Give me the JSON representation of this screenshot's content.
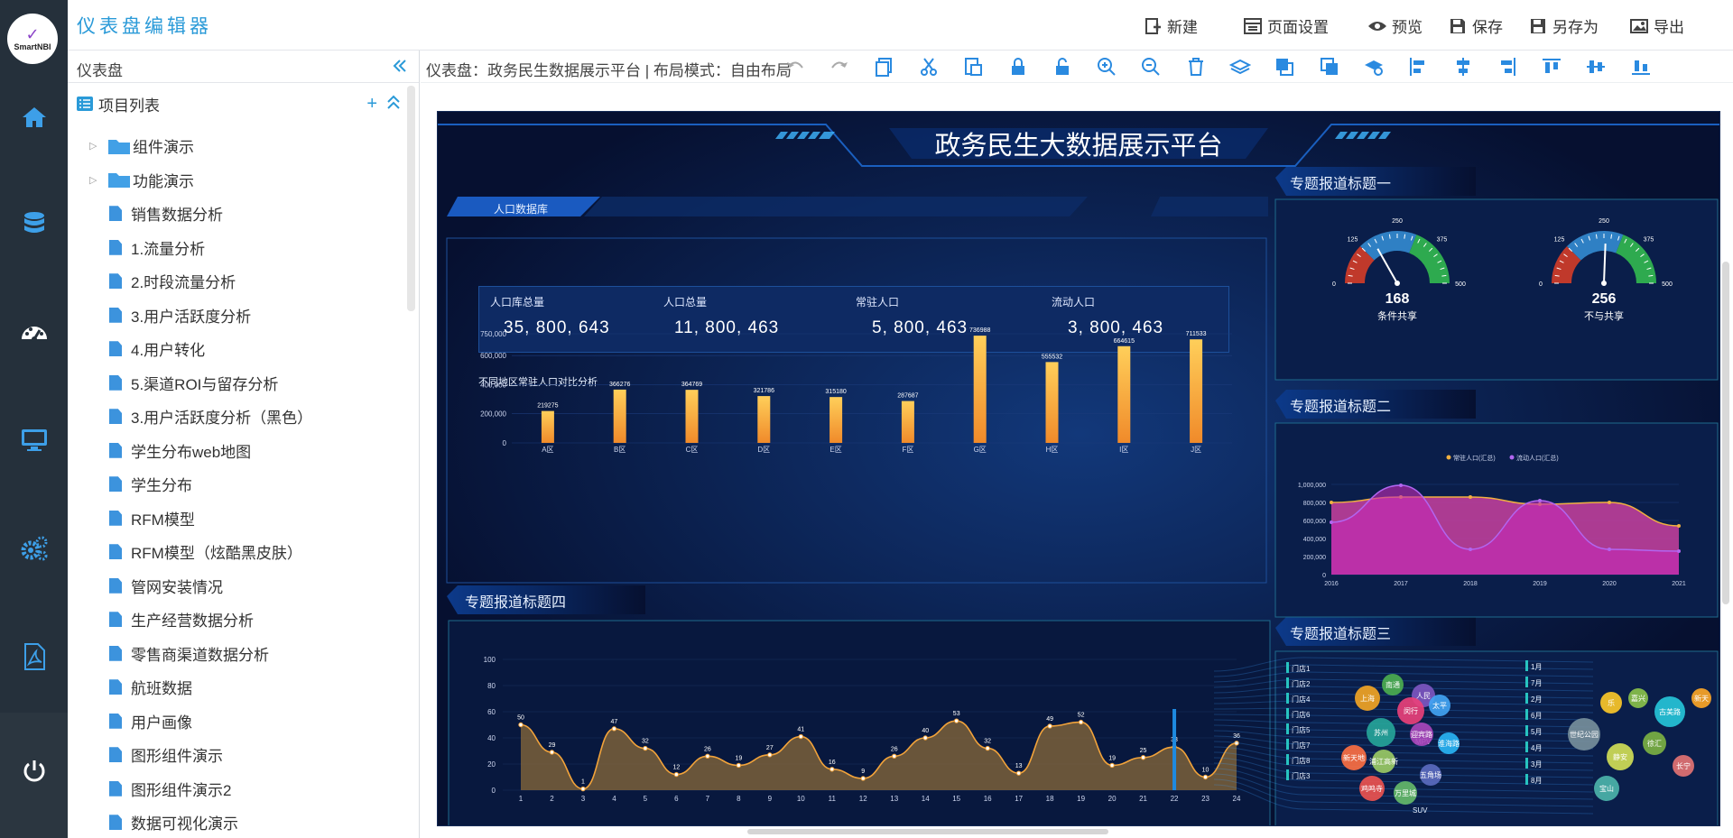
{
  "app": {
    "logo_text": "SmartNBI",
    "title": "仪表盘编辑器"
  },
  "header_actions": [
    {
      "label": "新建",
      "icon": "new-icon"
    },
    {
      "label": "页面设置",
      "icon": "page-settings-icon"
    },
    {
      "label": "预览",
      "icon": "eye-icon"
    },
    {
      "label": "保存",
      "icon": "save-icon"
    },
    {
      "label": "另存为",
      "icon": "save-as-icon"
    },
    {
      "label": "导出",
      "icon": "image-export-icon"
    }
  ],
  "rail": [
    "home-icon",
    "database-icon",
    "dashboard-icon",
    "monitor-icon",
    "gears-icon",
    "pdf-icon",
    "power-icon"
  ],
  "panel": {
    "title": "仪表盘",
    "list_title": "项目列表",
    "items": [
      {
        "label": "组件演示",
        "type": "folder"
      },
      {
        "label": "功能演示",
        "type": "folder"
      },
      {
        "label": "销售数据分析",
        "type": "doc"
      },
      {
        "label": "1.流量分析",
        "type": "doc"
      },
      {
        "label": "2.时段流量分析",
        "type": "doc"
      },
      {
        "label": "3.用户活跃度分析",
        "type": "doc"
      },
      {
        "label": "4.用户转化",
        "type": "doc"
      },
      {
        "label": "5.渠道ROI与留存分析",
        "type": "doc"
      },
      {
        "label": "3.用户活跃度分析（黑色）",
        "type": "doc"
      },
      {
        "label": "学生分布web地图",
        "type": "doc"
      },
      {
        "label": "学生分布",
        "type": "doc"
      },
      {
        "label": "RFM模型",
        "type": "doc"
      },
      {
        "label": "RFM模型（炫酷黑皮肤）",
        "type": "doc"
      },
      {
        "label": "管网安装情况",
        "type": "doc"
      },
      {
        "label": "生产经营数据分析",
        "type": "doc"
      },
      {
        "label": "零售商渠道数据分析",
        "type": "doc"
      },
      {
        "label": "航班数据",
        "type": "doc"
      },
      {
        "label": "用户画像",
        "type": "doc"
      },
      {
        "label": "图形组件演示",
        "type": "doc"
      },
      {
        "label": "图形组件演示2",
        "type": "doc"
      },
      {
        "label": "数据可视化演示",
        "type": "doc"
      }
    ]
  },
  "toolbar": {
    "breadcrumb": "仪表盘：政务民生数据展示平台 | 布局模式：自由布局",
    "tools": [
      "undo-icon",
      "redo-icon",
      "copy-icon",
      "cut-icon",
      "paste-icon",
      "lock-icon",
      "unlock-icon",
      "zoom-in-icon",
      "zoom-out-icon",
      "delete-icon",
      "layers-icon",
      "bring-front-icon",
      "send-back-icon",
      "layer-settings-icon",
      "align-left-icon",
      "align-center-icon",
      "align-right-icon",
      "align-top-icon",
      "align-middle-icon",
      "align-bottom-icon"
    ]
  },
  "dashboard": {
    "title": "政务民生大数据展示平台",
    "population_tab": "人口数据库",
    "kpis": [
      {
        "label": "人口库总量",
        "value": "35, 800, 643"
      },
      {
        "label": "人口总量",
        "value": "11, 800, 463"
      },
      {
        "label": "常驻人口",
        "value": "5, 800, 463"
      },
      {
        "label": "流动人口",
        "value": "3, 800, 463"
      }
    ],
    "bar_title": "不同地区常驻人口对比分析",
    "topic1": "专题报道标题一",
    "topic2": "专题报道标题二",
    "topic3": "专题报道标题三",
    "topic4": "专题报道标题四",
    "gauges": [
      {
        "value": 168,
        "label": "条件共享",
        "ticks": [
          "0",
          "125",
          "250",
          "375",
          "500"
        ]
      },
      {
        "value": 256,
        "label": "不与共享",
        "ticks": [
          "0",
          "125",
          "250",
          "375",
          "500"
        ]
      }
    ],
    "bubble_words": [
      "上海",
      "南通",
      "人民",
      "苏州",
      "闵行",
      "太平",
      "新天地",
      "浦江高新",
      "迎宾路",
      "淮海路",
      "鸡鸣寺",
      "万里城",
      "五角场",
      "乐",
      "嘉兴",
      "古美路",
      "新天",
      "世纪公园",
      "静安",
      "徐汇",
      "长宁",
      "宝山"
    ],
    "sankey_left": [
      "门店1",
      "门店2",
      "门店4",
      "门店6",
      "门店5",
      "门店7",
      "门店8",
      "门店3"
    ],
    "sankey_right": [
      "1月",
      "7月",
      "2月",
      "6月",
      "5月",
      "4月",
      "3月",
      "8月"
    ],
    "sankey_bottom": [
      "SUV",
      "MPV"
    ]
  },
  "chart_data": [
    {
      "type": "bar",
      "title": "不同地区常驻人口对比分析",
      "categories": [
        "A区",
        "B区",
        "C区",
        "D区",
        "E区",
        "F区",
        "G区",
        "H区",
        "I区",
        "J区"
      ],
      "values": [
        219275,
        366276,
        364769,
        321786,
        315180,
        287687,
        736988,
        555532,
        664615,
        711533
      ],
      "ylim": [
        0,
        750000
      ],
      "yticks": [
        "0",
        "200,000",
        "400,000",
        "600,000",
        "750,000"
      ]
    },
    {
      "type": "area",
      "x": [
        "2016",
        "2017",
        "2018",
        "2019",
        "2020",
        "2021"
      ],
      "series": [
        {
          "name": "常驻人口(汇总)",
          "values": [
            800000,
            860000,
            860000,
            780000,
            800000,
            540000
          ],
          "color": "#f0b040"
        },
        {
          "name": "流动人口(汇总)",
          "values": [
            580000,
            990000,
            280000,
            820000,
            280000,
            260000
          ],
          "color": "#b266f0"
        }
      ],
      "ylim": [
        0,
        1000000
      ],
      "yticks": [
        "0",
        "200,000",
        "400,000",
        "600,000",
        "800,000",
        "1,000,000"
      ]
    },
    {
      "type": "area",
      "title": "专题报道标题四",
      "x": [
        1,
        2,
        3,
        4,
        5,
        6,
        7,
        8,
        9,
        10,
        11,
        12,
        13,
        14,
        15,
        16,
        17,
        18,
        19,
        20,
        21,
        22,
        23,
        24
      ],
      "values": [
        50,
        29,
        1,
        47,
        32,
        12,
        26,
        19,
        27,
        41,
        16,
        9,
        26,
        40,
        53,
        32,
        13,
        49,
        52,
        19,
        25,
        33,
        10,
        36
      ],
      "ylim": [
        0,
        100
      ],
      "yticks": [
        "0",
        "20",
        "40",
        "60",
        "80",
        "100"
      ]
    }
  ]
}
